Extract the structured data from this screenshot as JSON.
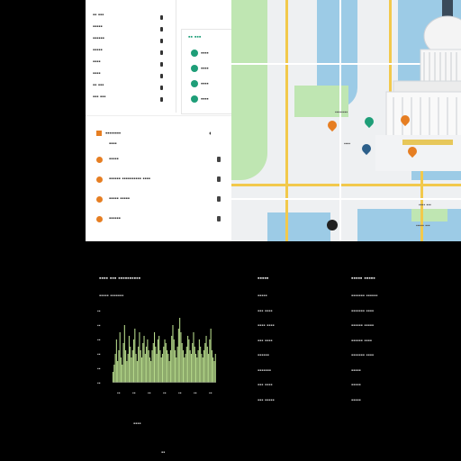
{
  "app": {
    "left_list": [
      {
        "label": "▪▪ ▪▪▪"
      },
      {
        "label": "▪▪▪▪▪"
      },
      {
        "label": "▪▪▪▪▪▪"
      },
      {
        "label": "▪▪▪▪▪"
      },
      {
        "label": "▪▪▪▪"
      },
      {
        "label": "▪▪▪▪"
      },
      {
        "label": "▪▪ ▪▪▪"
      },
      {
        "label": "▪▪▪ ▪▪▪"
      }
    ],
    "green_tag": "▪▪ ▪▪▪",
    "legend": [
      {
        "label": "▪▪▪▪"
      },
      {
        "label": "▪▪▪▪"
      },
      {
        "label": "▪▪▪▪"
      },
      {
        "label": "▪▪▪▪"
      }
    ],
    "poi_header": "▪▪▪▪▪▪▪▪",
    "poi_sub": "▪▪▪▪",
    "pois": [
      {
        "label": "▪▪▪▪▪"
      },
      {
        "label": "▪▪▪▪▪▪ ▪▪▪▪▪▪▪▪▪▪ ▪▪▪▪"
      },
      {
        "label": "▪▪▪▪▪ ▪▪▪▪▪"
      },
      {
        "label": "▪▪▪▪▪▪"
      }
    ],
    "map_labels": [
      "▪▪▪▪▪▪▪▪",
      "▪▪▪▪ ▪▪▪",
      "▪▪▪▪",
      "▪▪▪▪▪ ▪▪▪"
    ]
  },
  "bottom": {
    "chart_title": "▪▪▪▪ ▪▪▪ ▪▪▪▪▪▪▪▪▪▪",
    "chart_subtitle": "▪▪▪▪▪ ▪▪▪▪▪▪▪",
    "y_ticks": [
      "▪▪",
      "▪▪",
      "▪▪",
      "▪▪",
      "▪▪",
      "▪▪"
    ],
    "x_ticks": [
      "▪▪",
      "▪▪",
      "▪▪",
      "▪▪",
      "▪▪",
      "▪▪",
      "▪▪"
    ],
    "chart_footer": "▪▪▪▪",
    "page_num": "▪▪",
    "col2_title": "▪▪▪▪▪",
    "col2_items": [
      "▪▪▪▪▪",
      "▪▪▪ ▪▪▪▪",
      "▪▪▪▪ ▪▪▪▪",
      "▪▪▪ ▪▪▪▪",
      "▪▪▪▪▪▪",
      "▪▪▪▪▪▪▪",
      "▪▪▪ ▪▪▪▪",
      "▪▪▪ ▪▪▪▪▪"
    ],
    "col3_title": "▪▪▪▪▪ ▪▪▪▪▪",
    "col3_items": [
      "▪▪▪▪▪▪▪ ▪▪▪▪▪▪",
      "▪▪▪▪▪▪▪ ▪▪▪▪",
      "▪▪▪▪▪▪ ▪▪▪▪▪",
      "▪▪▪▪▪▪ ▪▪▪▪",
      "▪▪▪▪▪▪▪ ▪▪▪▪",
      "▪▪▪▪▪",
      "▪▪▪▪▪",
      "▪▪▪▪▪"
    ],
    "accent": "#b5d98a"
  },
  "chart_data": {
    "type": "bar",
    "values": [
      3,
      5,
      8,
      12,
      6,
      9,
      14,
      7,
      5,
      11,
      16,
      9,
      6,
      8,
      13,
      10,
      7,
      9,
      12,
      15,
      8,
      6,
      10,
      14,
      9,
      7,
      11,
      13,
      8,
      10,
      12,
      9,
      7,
      6,
      9,
      11,
      14,
      10,
      8,
      12,
      13,
      9,
      7,
      8,
      10,
      12,
      11,
      9,
      8,
      6,
      9,
      13,
      16,
      12,
      9,
      7,
      10,
      15,
      18,
      14,
      11,
      9,
      7,
      8,
      10,
      13,
      12,
      9,
      8,
      11,
      14,
      10,
      8,
      7,
      9,
      12,
      10,
      8,
      7,
      9,
      11,
      13,
      10,
      8,
      12,
      15,
      9,
      7,
      6,
      8
    ],
    "ylim": [
      0,
      20
    ]
  }
}
